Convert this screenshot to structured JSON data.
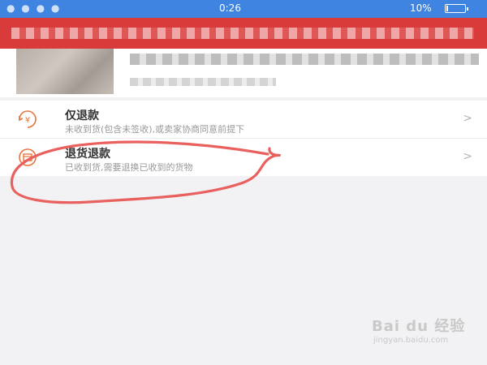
{
  "status_bar": {
    "time": "0:26",
    "battery": "10%"
  },
  "options": [
    {
      "label": "仅退款",
      "desc": "未收到货(包含未签收),或卖家协商同意前提下",
      "chevron": ">"
    },
    {
      "label": "退货退款",
      "desc": "已收到货,需要退换已收到的货物",
      "chevron": ">"
    }
  ],
  "colors": {
    "accent": "#e8743b",
    "header": "#d93a3a",
    "status_bar": "#3f84e0",
    "annotation": "#e9615e"
  },
  "icons": [
    "refund-money-icon",
    "return-goods-icon",
    "chevron-right-icon",
    "battery-icon"
  ],
  "watermark": {
    "logo": "Bai du 经验",
    "site": "jingyan.baidu.com"
  }
}
